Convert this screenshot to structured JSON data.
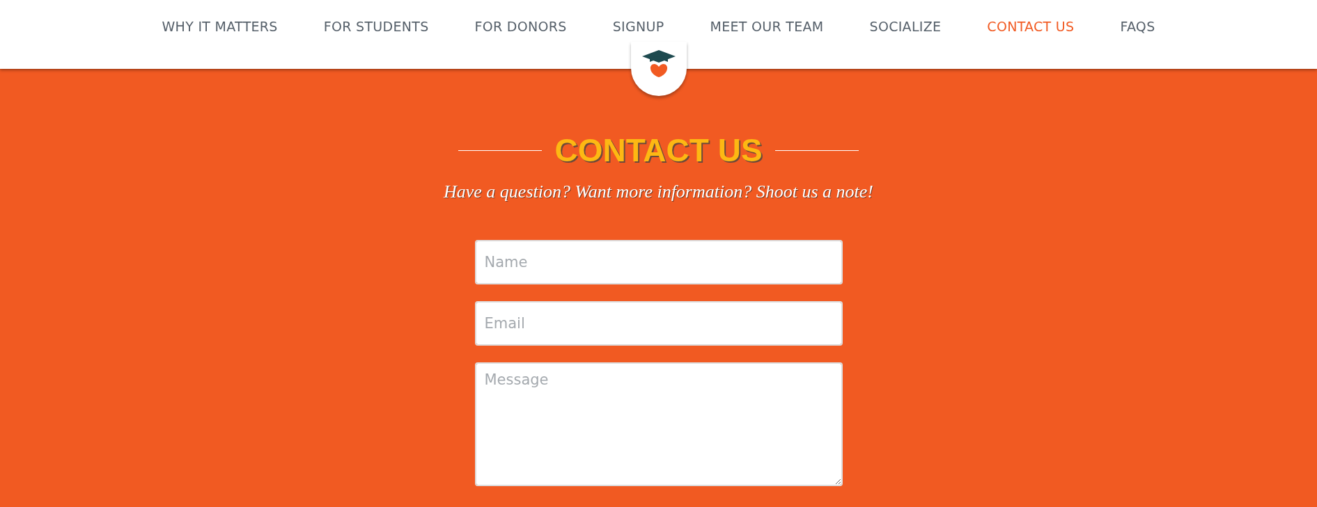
{
  "nav": [
    {
      "label": "WHY IT MATTERS",
      "selected": false
    },
    {
      "label": "FOR STUDENTS",
      "selected": false
    },
    {
      "label": "FOR DONORS",
      "selected": false
    },
    {
      "label": "SIGNUP",
      "selected": false
    },
    {
      "label": "MEET OUR TEAM",
      "selected": false
    },
    {
      "label": "SOCIALIZE",
      "selected": false
    },
    {
      "label": "CONTACT US",
      "selected": true
    },
    {
      "label": "FAQS",
      "selected": false
    }
  ],
  "section": {
    "title": "CONTACT US",
    "subtitle": "Have a question? Want more information? Shoot us a note!"
  },
  "form": {
    "fields": [
      {
        "kind": "input",
        "placeholder": "Name"
      },
      {
        "kind": "input",
        "placeholder": "Email"
      },
      {
        "kind": "textarea",
        "placeholder": "Message"
      }
    ]
  }
}
